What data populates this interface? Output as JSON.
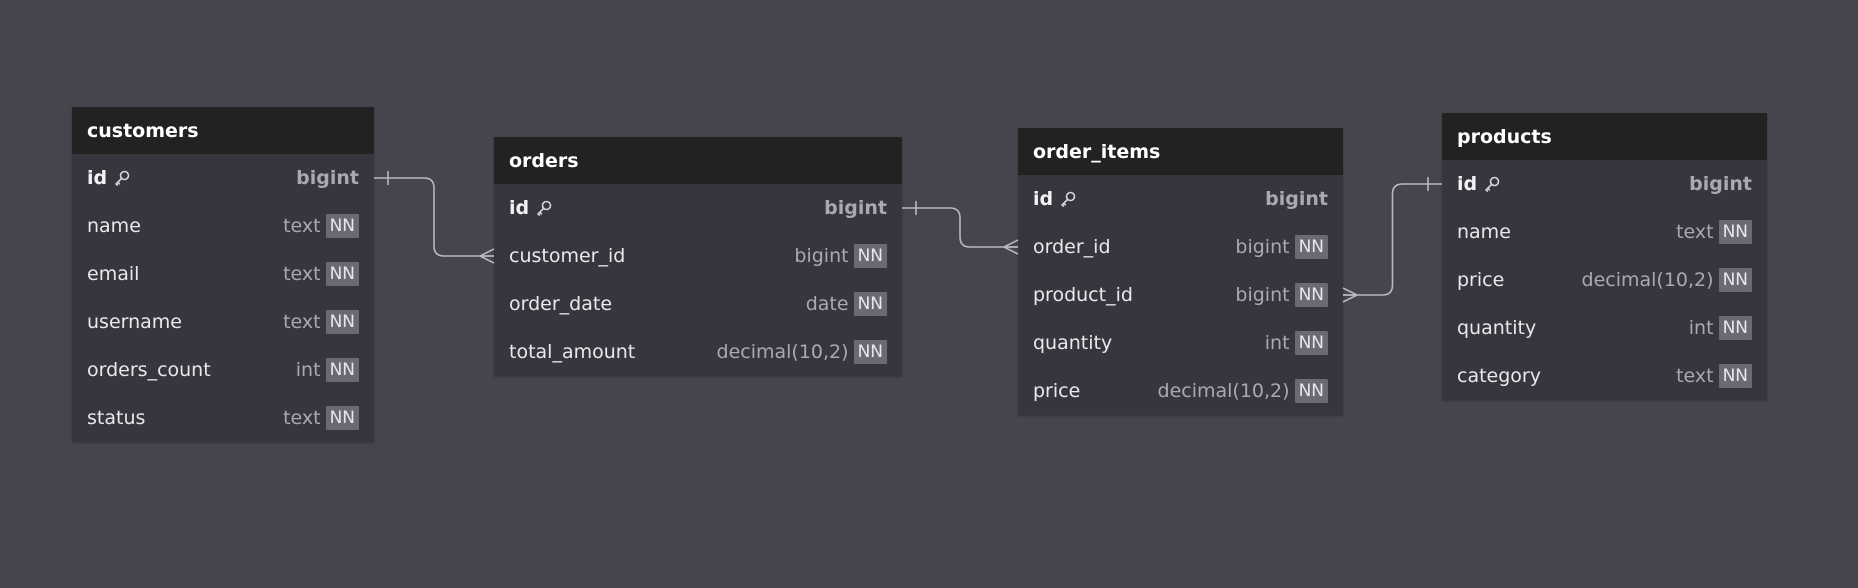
{
  "colors": {
    "background": "#45454e",
    "table_body": "#36363e",
    "table_header": "#222222",
    "connector": "#b8b8be",
    "nn_badge": "#6a6a72"
  },
  "tables": [
    {
      "name": "customers",
      "columns": [
        {
          "name": "id",
          "type": "bigint",
          "primary_key": true,
          "not_null": false
        },
        {
          "name": "name",
          "type": "text",
          "primary_key": false,
          "not_null": true
        },
        {
          "name": "email",
          "type": "text",
          "primary_key": false,
          "not_null": true
        },
        {
          "name": "username",
          "type": "text",
          "primary_key": false,
          "not_null": true
        },
        {
          "name": "orders_count",
          "type": "int",
          "primary_key": false,
          "not_null": true
        },
        {
          "name": "status",
          "type": "text",
          "primary_key": false,
          "not_null": true
        }
      ]
    },
    {
      "name": "orders",
      "columns": [
        {
          "name": "id",
          "type": "bigint",
          "primary_key": true,
          "not_null": false
        },
        {
          "name": "customer_id",
          "type": "bigint",
          "primary_key": false,
          "not_null": true
        },
        {
          "name": "order_date",
          "type": "date",
          "primary_key": false,
          "not_null": true
        },
        {
          "name": "total_amount",
          "type": "decimal(10,2)",
          "primary_key": false,
          "not_null": true
        }
      ]
    },
    {
      "name": "order_items",
      "columns": [
        {
          "name": "id",
          "type": "bigint",
          "primary_key": true,
          "not_null": false
        },
        {
          "name": "order_id",
          "type": "bigint",
          "primary_key": false,
          "not_null": true
        },
        {
          "name": "product_id",
          "type": "bigint",
          "primary_key": false,
          "not_null": true
        },
        {
          "name": "quantity",
          "type": "int",
          "primary_key": false,
          "not_null": true
        },
        {
          "name": "price",
          "type": "decimal(10,2)",
          "primary_key": false,
          "not_null": true
        }
      ]
    },
    {
      "name": "products",
      "columns": [
        {
          "name": "id",
          "type": "bigint",
          "primary_key": true,
          "not_null": false
        },
        {
          "name": "name",
          "type": "text",
          "primary_key": false,
          "not_null": true
        },
        {
          "name": "price",
          "type": "decimal(10,2)",
          "primary_key": false,
          "not_null": true
        },
        {
          "name": "quantity",
          "type": "int",
          "primary_key": false,
          "not_null": true
        },
        {
          "name": "category",
          "type": "text",
          "primary_key": false,
          "not_null": true
        }
      ]
    }
  ],
  "nn_label": "NN",
  "relations": [
    {
      "from": "orders.customer_id",
      "to": "customers.id",
      "cardinality": "many-to-one"
    },
    {
      "from": "order_items.order_id",
      "to": "orders.id",
      "cardinality": "many-to-one"
    },
    {
      "from": "order_items.product_id",
      "to": "products.id",
      "cardinality": "many-to-one"
    }
  ]
}
